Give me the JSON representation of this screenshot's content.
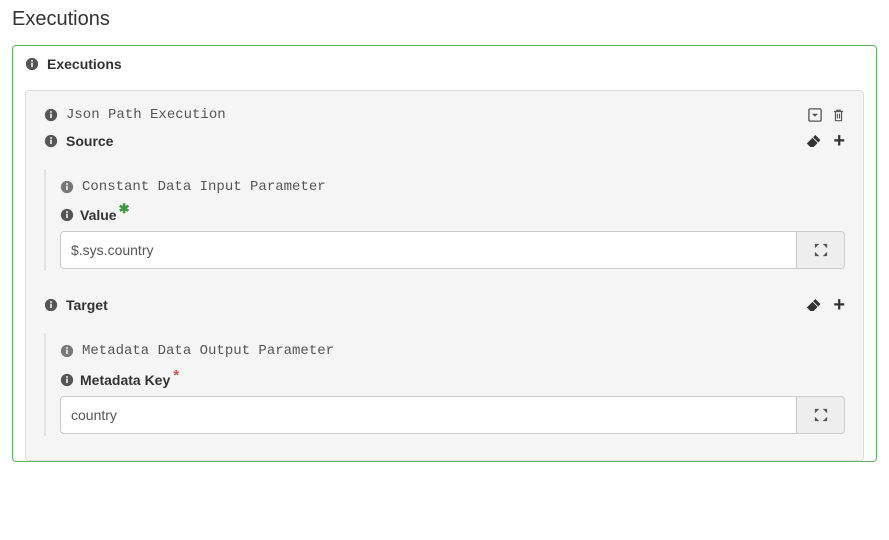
{
  "page": {
    "title": "Executions"
  },
  "panel": {
    "title": "Executions"
  },
  "card": {
    "type": "Json Path Execution",
    "source": {
      "label": "Source",
      "param_type": "Constant Data Input Parameter",
      "field_label": "Value",
      "value": "$.sys.country"
    },
    "target": {
      "label": "Target",
      "param_type": "Metadata Data Output Parameter",
      "field_label": "Metadata Key",
      "value": "country"
    }
  },
  "icons": {
    "info": "info-circle",
    "dropdown": "caret-down-box",
    "trash": "trash",
    "eraser": "eraser",
    "plus": "plus",
    "expand": "arrows-expand"
  }
}
